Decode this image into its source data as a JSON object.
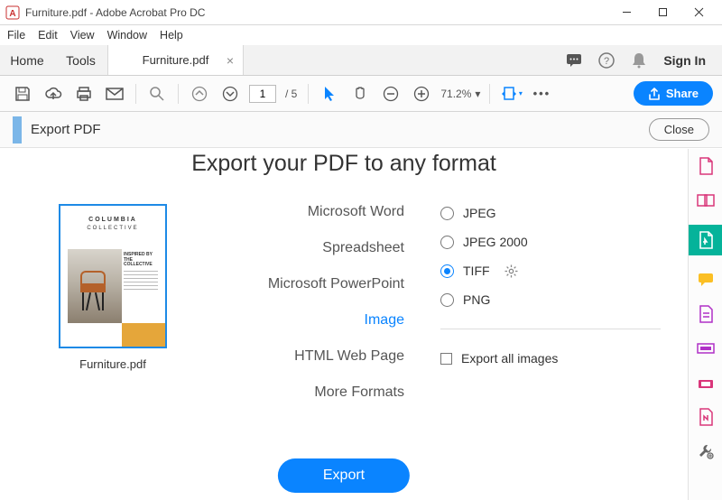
{
  "window": {
    "title": "Furniture.pdf - Adobe Acrobat Pro DC"
  },
  "menu": {
    "file": "File",
    "edit": "Edit",
    "view": "View",
    "window": "Window",
    "help": "Help"
  },
  "tabs": {
    "home": "Home",
    "tools": "Tools",
    "doc": "Furniture.pdf",
    "signin": "Sign In"
  },
  "toolbar": {
    "page_current": "1",
    "page_total": "/ 5",
    "zoom": "71.2%",
    "share": "Share"
  },
  "panel": {
    "title": "Export PDF",
    "close": "Close"
  },
  "export": {
    "headline": "Export your PDF to any format",
    "thumb_label": "Furniture.pdf",
    "thumb_brand_top": "COLUMBIA",
    "thumb_brand_sub": "COLLECTIVE",
    "thumb_caption": "INSPIRED BY THE COLLECTIVE",
    "formats": {
      "word": "Microsoft Word",
      "spreadsheet": "Spreadsheet",
      "ppt": "Microsoft PowerPoint",
      "image": "Image",
      "html": "HTML Web Page",
      "more": "More Formats"
    },
    "image_options": {
      "jpeg": "JPEG",
      "jpeg2000": "JPEG 2000",
      "tiff": "TIFF",
      "png": "PNG",
      "all": "Export all images"
    },
    "button": "Export"
  }
}
